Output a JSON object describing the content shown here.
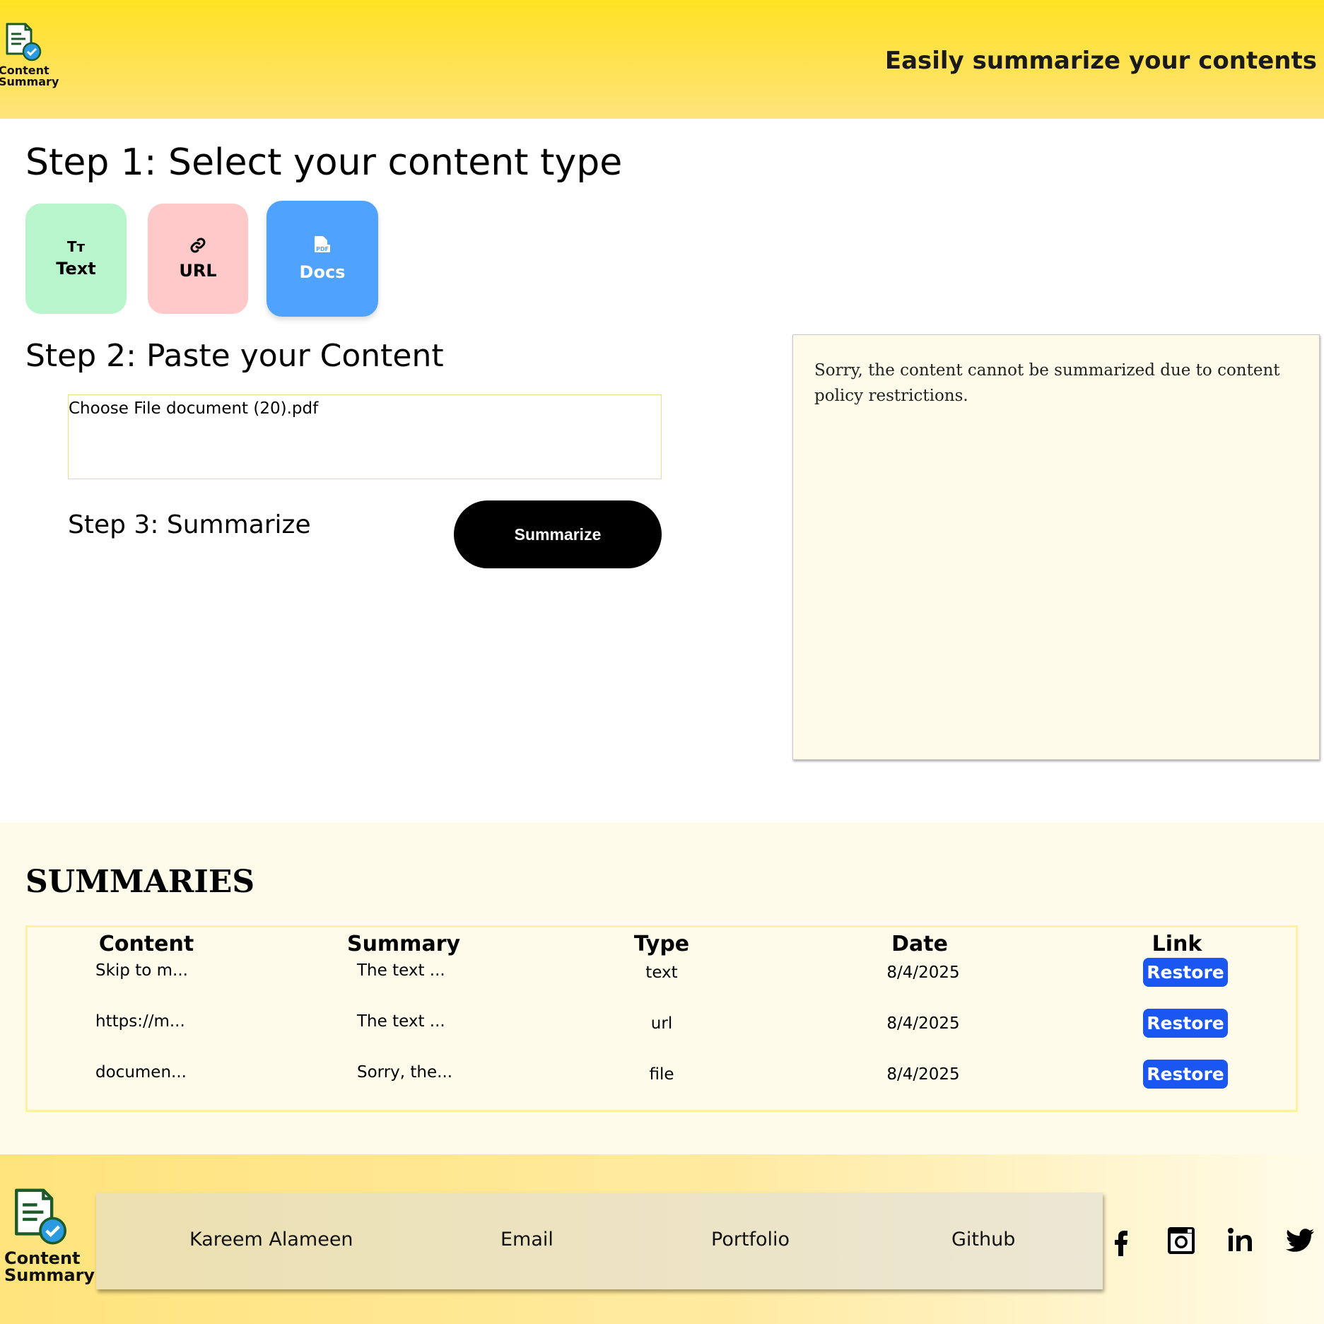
{
  "header": {
    "logo_line1": "Content",
    "logo_line2": "Summary",
    "tagline": "Easily summarize your contents"
  },
  "step1": {
    "title": "Step 1: Select your content type",
    "types": [
      {
        "label": "Text",
        "icon": "text-size-icon",
        "icon_glyph": "Tт",
        "color": "#b8f5cc"
      },
      {
        "label": "URL",
        "icon": "link-icon",
        "color": "#ffc9c9"
      },
      {
        "label": "Docs",
        "icon": "pdf-file-icon",
        "color": "#4fa3ff",
        "selected": true
      }
    ]
  },
  "step2": {
    "title": "Step 2: Paste your Content",
    "file_button": "Choose File",
    "file_name": "document (20).pdf"
  },
  "step3": {
    "title": "Step 3: Summarize",
    "button": "Summarize"
  },
  "result": {
    "text": "Sorry, the content cannot be summarized due to content policy restrictions."
  },
  "summaries": {
    "title": "SUMMARIES",
    "columns": [
      "Content",
      "Summary",
      "Type",
      "Date",
      "Link"
    ],
    "rows": [
      {
        "content": "Skip to m...",
        "summary": "The text ...",
        "type": "text",
        "date": "8/4/2025",
        "link": "Restore"
      },
      {
        "content": "https://m...",
        "summary": "The text ...",
        "type": "url",
        "date": "8/4/2025",
        "link": "Restore"
      },
      {
        "content": "documen...",
        "summary": "Sorry, the...",
        "type": "file",
        "date": "8/4/2025",
        "link": "Restore"
      }
    ]
  },
  "footer": {
    "logo_line1": "Content",
    "logo_line2": "Summary",
    "links": [
      "Kareem Alameen",
      "Email",
      "Portfolio",
      "Github"
    ],
    "social_icons": [
      "facebook-icon",
      "instagram-icon",
      "linkedin-icon",
      "twitter-icon"
    ]
  },
  "colors": {
    "header_yellow": "#ffe222",
    "panel_cream": "#fffbea",
    "restore_blue": "#1a57f0",
    "docs_blue": "#4fa3ff"
  }
}
